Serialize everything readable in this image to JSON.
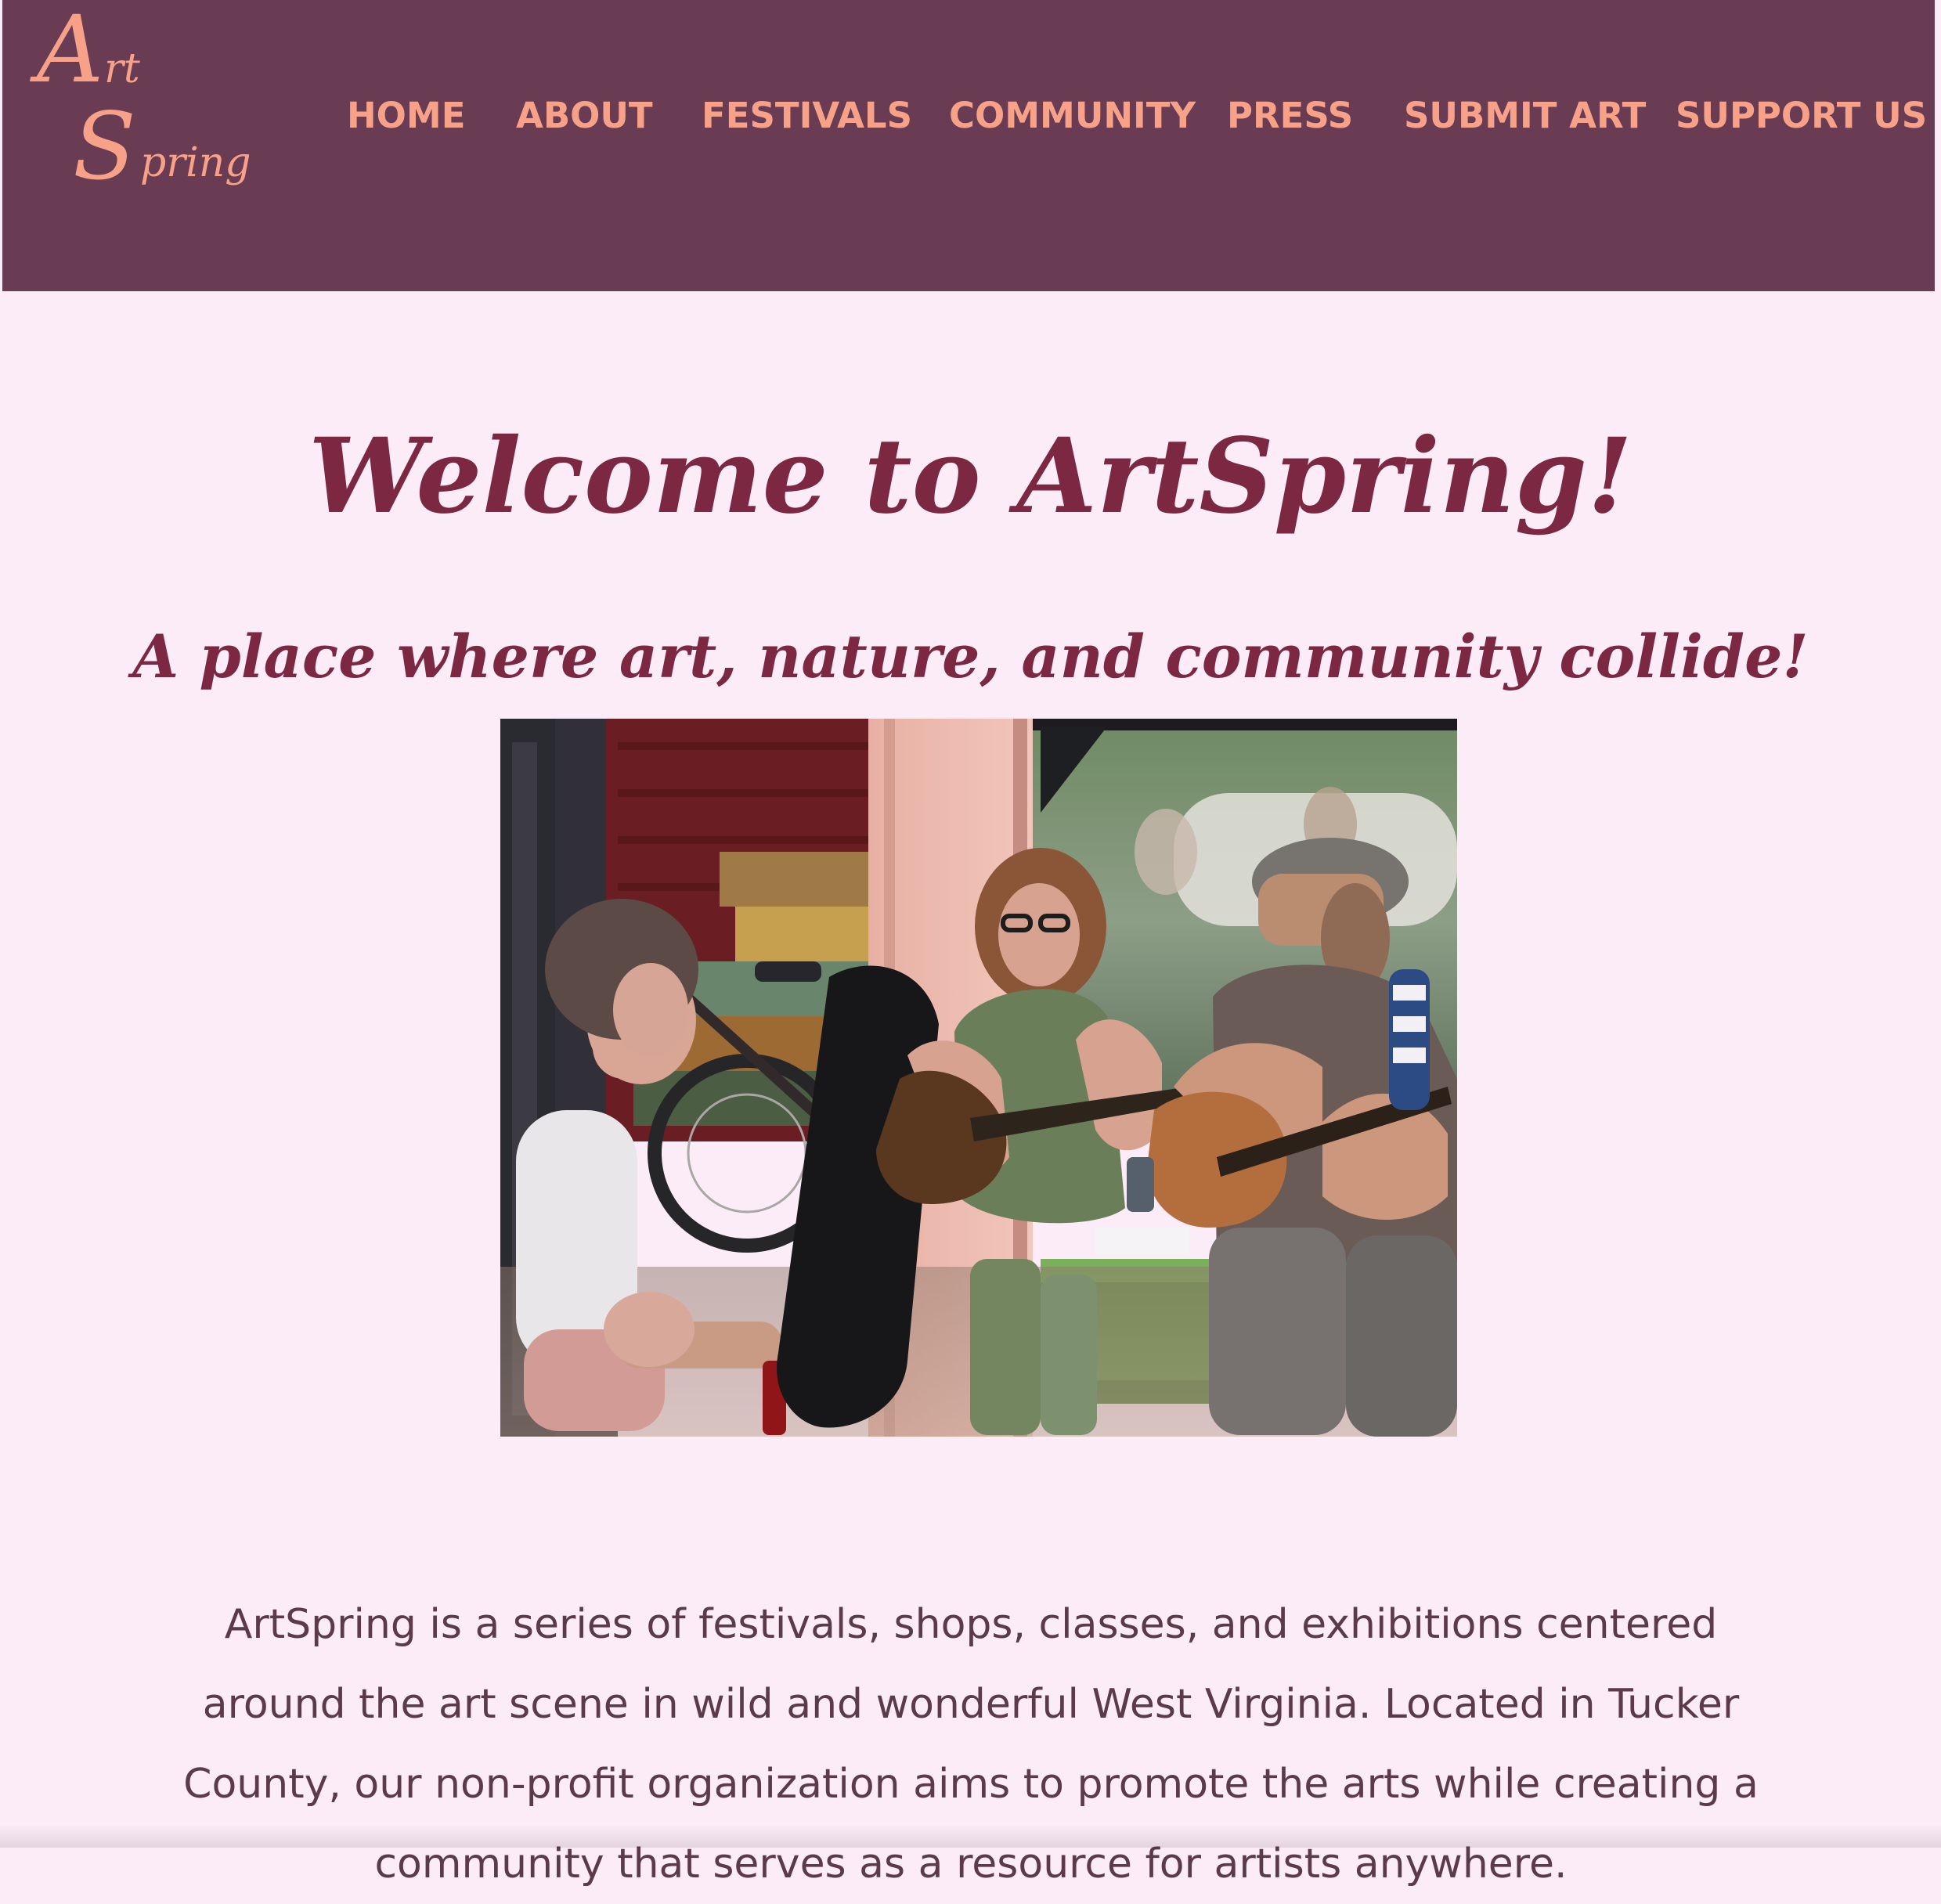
{
  "header": {
    "logo": {
      "letter_a": "A",
      "suffix_rt": "rt",
      "letter_s": "S",
      "suffix_pring": "pring"
    },
    "nav": [
      {
        "label": "HOME"
      },
      {
        "label": "ABOUT"
      },
      {
        "label": "FESTIVALS"
      },
      {
        "label": "COMMUNITY"
      },
      {
        "label": "PRESS"
      },
      {
        "label": "SUBMIT ART"
      },
      {
        "label": "SUPPORT US"
      }
    ]
  },
  "main": {
    "title": "Welcome to ArtSpring!",
    "subtitle": "A place where art, nature, and community collide!",
    "intro": "ArtSpring is a series of festivals, shops, classes, and exhibitions centered around the art scene in wild and wonderful West Virginia. Located in Tucker County, our non-profit organization aims to promote the arts while creating a community that serves as a resource for artists anywhere."
  },
  "colors": {
    "header_bg": "#693c53",
    "nav_text": "#f7a288",
    "page_bg": "#fcecf8",
    "heading": "#7d2843",
    "body_text": "#5b3a4a"
  }
}
